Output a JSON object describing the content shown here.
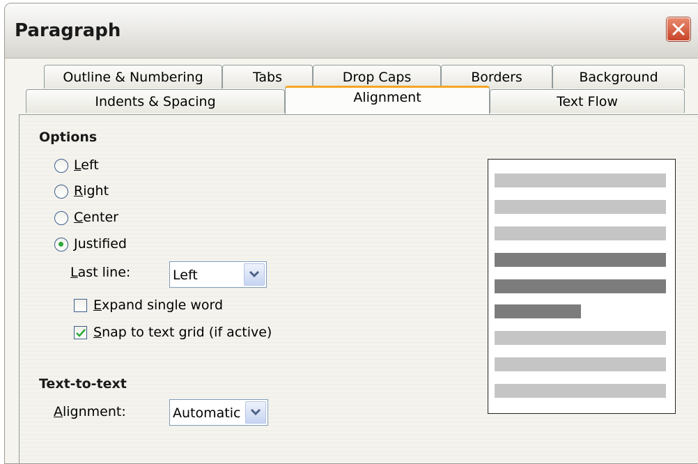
{
  "window": {
    "title": "Paragraph"
  },
  "tabs": {
    "row1": [
      "Outline & Numbering",
      "Tabs",
      "Drop Caps",
      "Borders",
      "Background"
    ],
    "row2": [
      "Indents & Spacing",
      "Alignment",
      "Text Flow"
    ],
    "active": "Alignment"
  },
  "options": {
    "title": "Options",
    "radios": [
      {
        "mnemonic": "L",
        "rest": "eft",
        "selected": false
      },
      {
        "mnemonic": "R",
        "rest": "ight",
        "selected": false
      },
      {
        "mnemonic": "C",
        "rest": "enter",
        "selected": false
      },
      {
        "mnemonic": "J",
        "rest": "ustified",
        "selected": true
      }
    ],
    "last_line": {
      "mnemonic": "L",
      "rest": "ast line:",
      "value": "Left"
    },
    "expand_single_word": {
      "mnemonic": "E",
      "rest": "xpand single word",
      "checked": false
    },
    "snap_to_grid": {
      "mnemonic": "S",
      "rest": "nap to text grid (if active)",
      "checked": true
    }
  },
  "text_to_text": {
    "title": "Text-to-text",
    "alignment": {
      "mnemonic": "A",
      "rest": "lignment:",
      "value": "Automatic"
    }
  },
  "preview": {
    "line_shades": [
      "light",
      "light",
      "light",
      "dark",
      "dark",
      "dark-short",
      "light",
      "light",
      "light"
    ]
  },
  "colors": {
    "active_tab_accent": "#f5a623",
    "close_button": "#c8452a",
    "radio_selected": "#2fa83a",
    "check_mark": "#2fa83a"
  }
}
